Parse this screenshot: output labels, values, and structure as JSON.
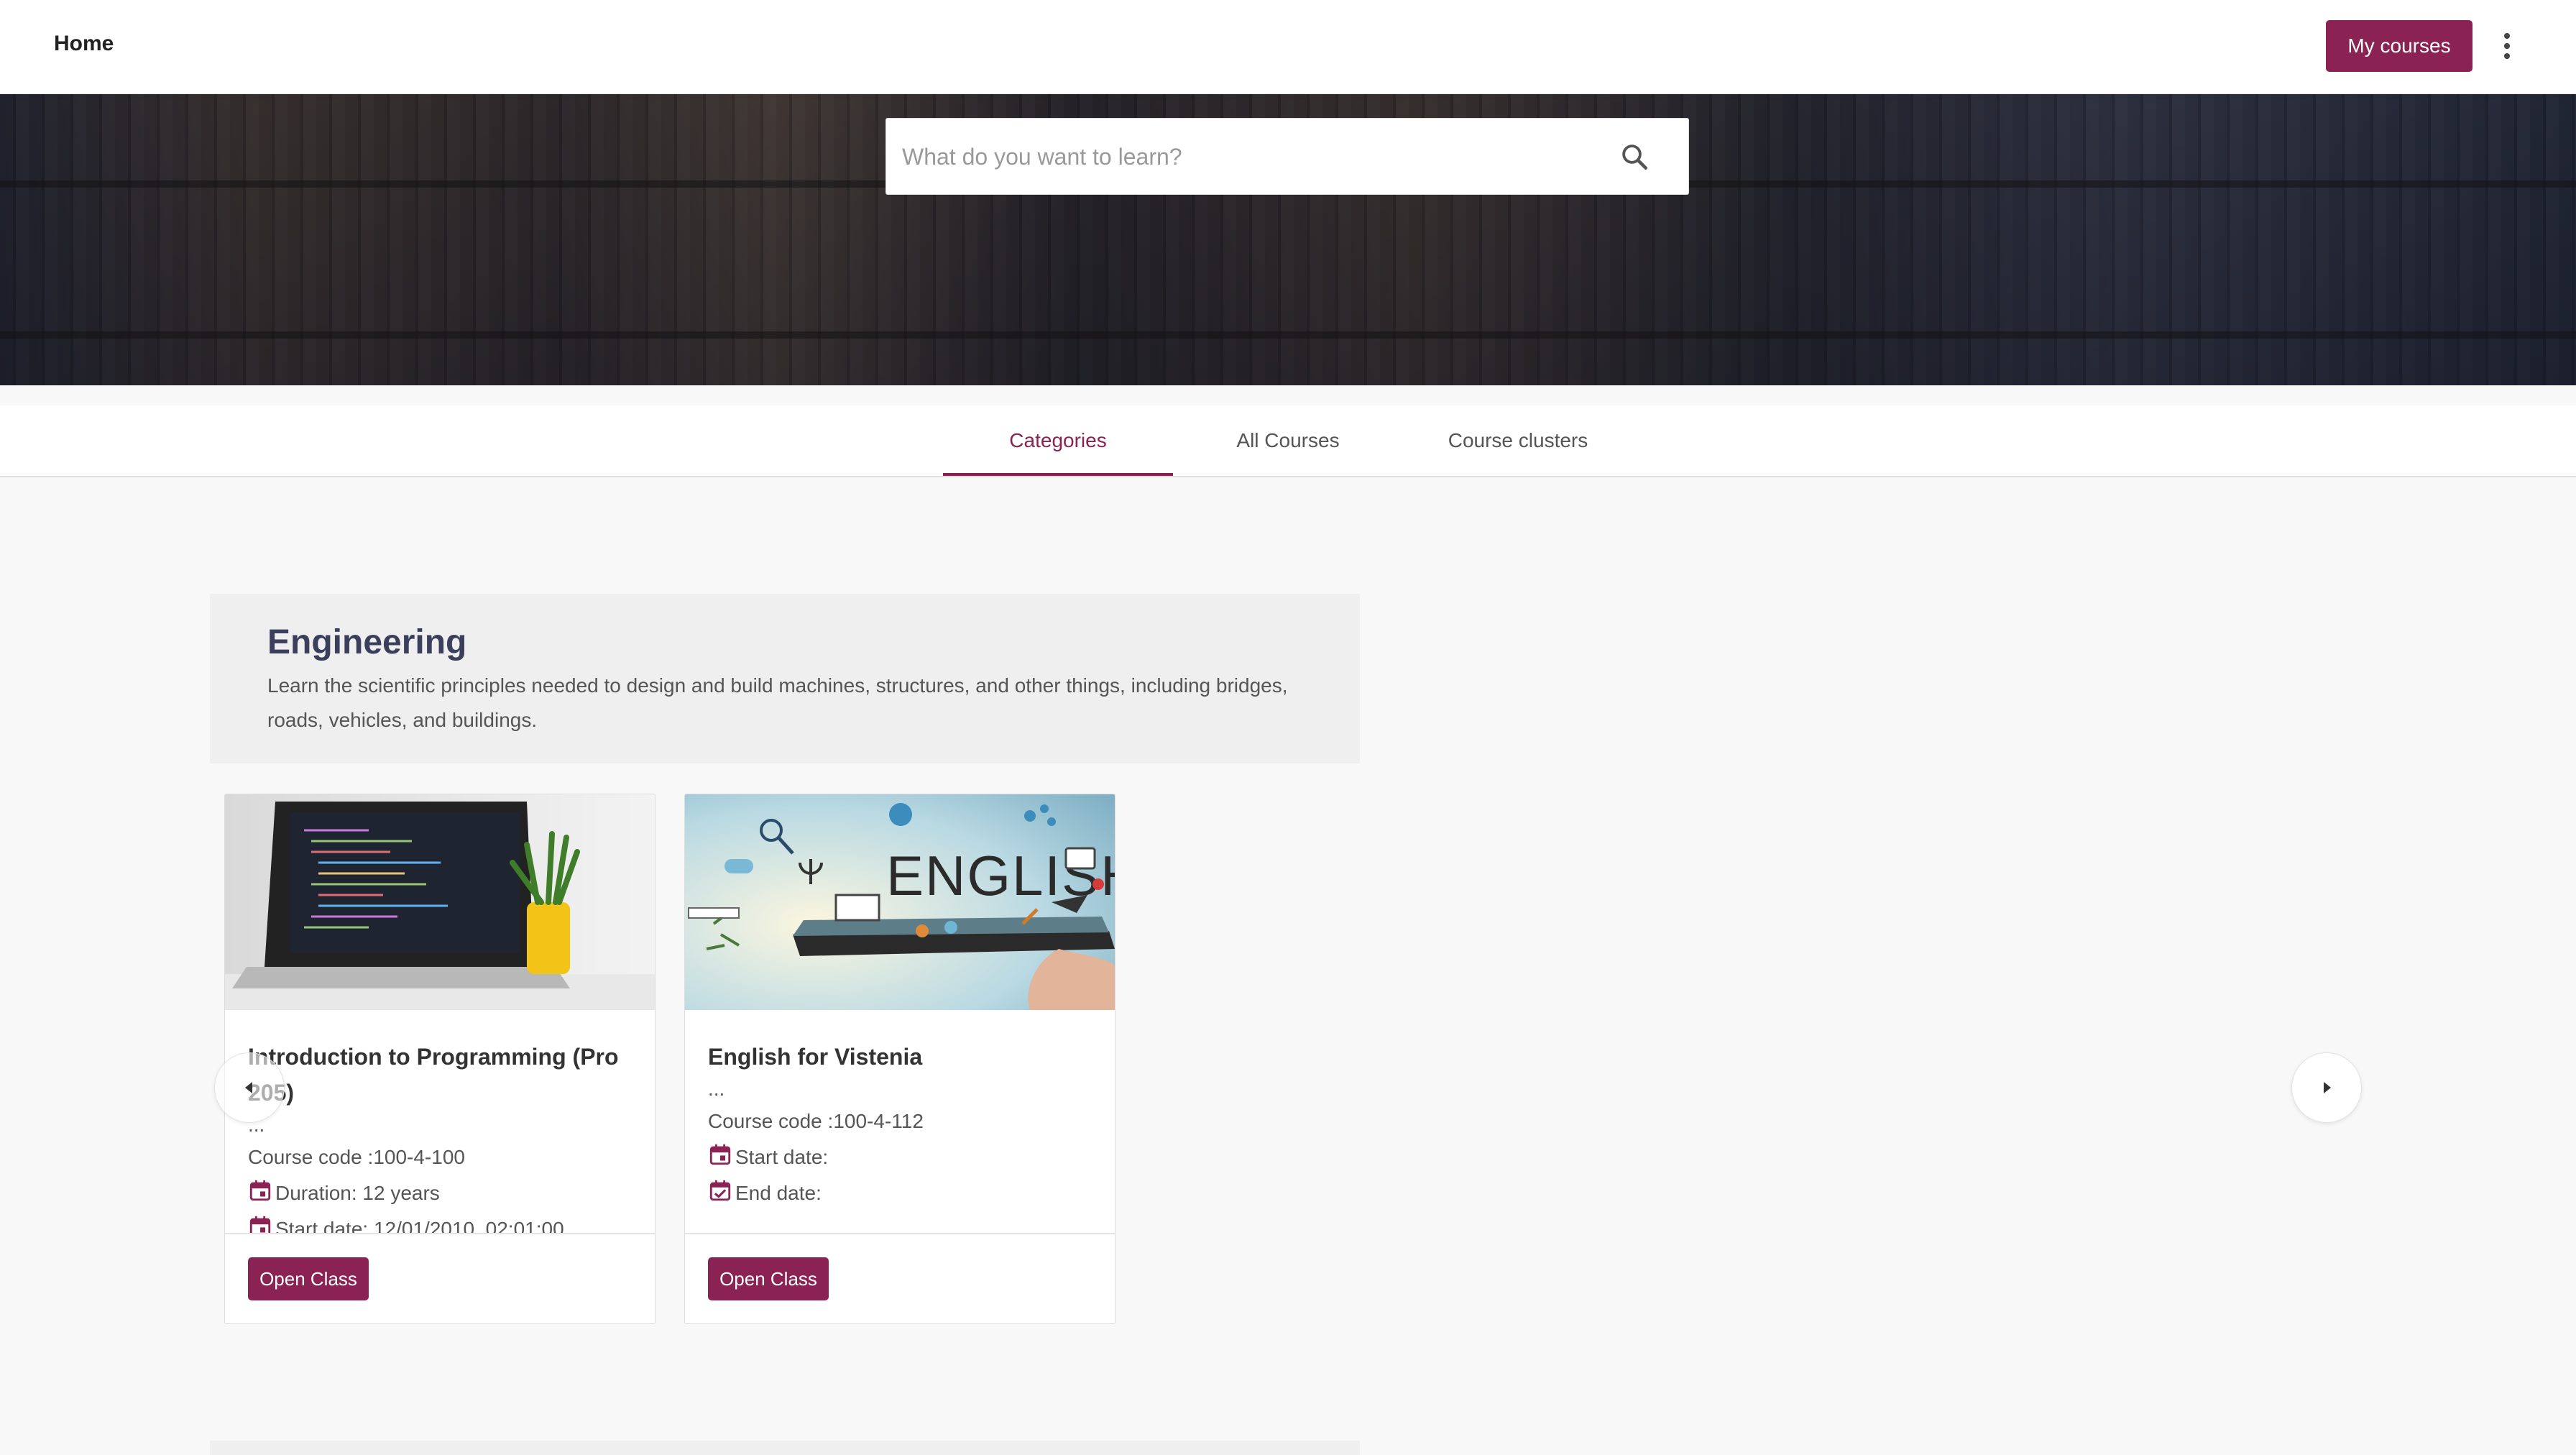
{
  "header": {
    "home_label": "Home",
    "my_courses_label": "My courses"
  },
  "search": {
    "placeholder": "What do you want to learn?"
  },
  "tabs": [
    {
      "label": "Categories",
      "active": true
    },
    {
      "label": "All Courses",
      "active": false
    },
    {
      "label": "Course clusters",
      "active": false
    }
  ],
  "category": {
    "title": "Engineering",
    "description": "Learn the scientific principles needed to design and build machines, structures, and other things, including bridges, roads, vehicles, and buildings."
  },
  "courses": [
    {
      "title": "Introduction to Programming (Pro 205)",
      "ellipsis": "...",
      "code": "Course code :100-4-100",
      "duration": "Duration: 12 years",
      "start": "Start date: 12/01/2010, 02:01:00",
      "button": "Open Class",
      "image": "laptop-image"
    },
    {
      "title": "English for Vistenia",
      "ellipsis": "...",
      "code": "Course code :100-4-112",
      "start": "Start date:",
      "end": "End date:",
      "button": "Open Class",
      "image": "english-tablet-image"
    }
  ],
  "colors": {
    "accent": "#8a2354",
    "category_title": "#3b3f5c"
  },
  "icons": [
    "search-icon",
    "kebab-menu-icon",
    "calendar-icon",
    "calendar-check-icon",
    "chevron-left-icon",
    "chevron-right-icon"
  ]
}
